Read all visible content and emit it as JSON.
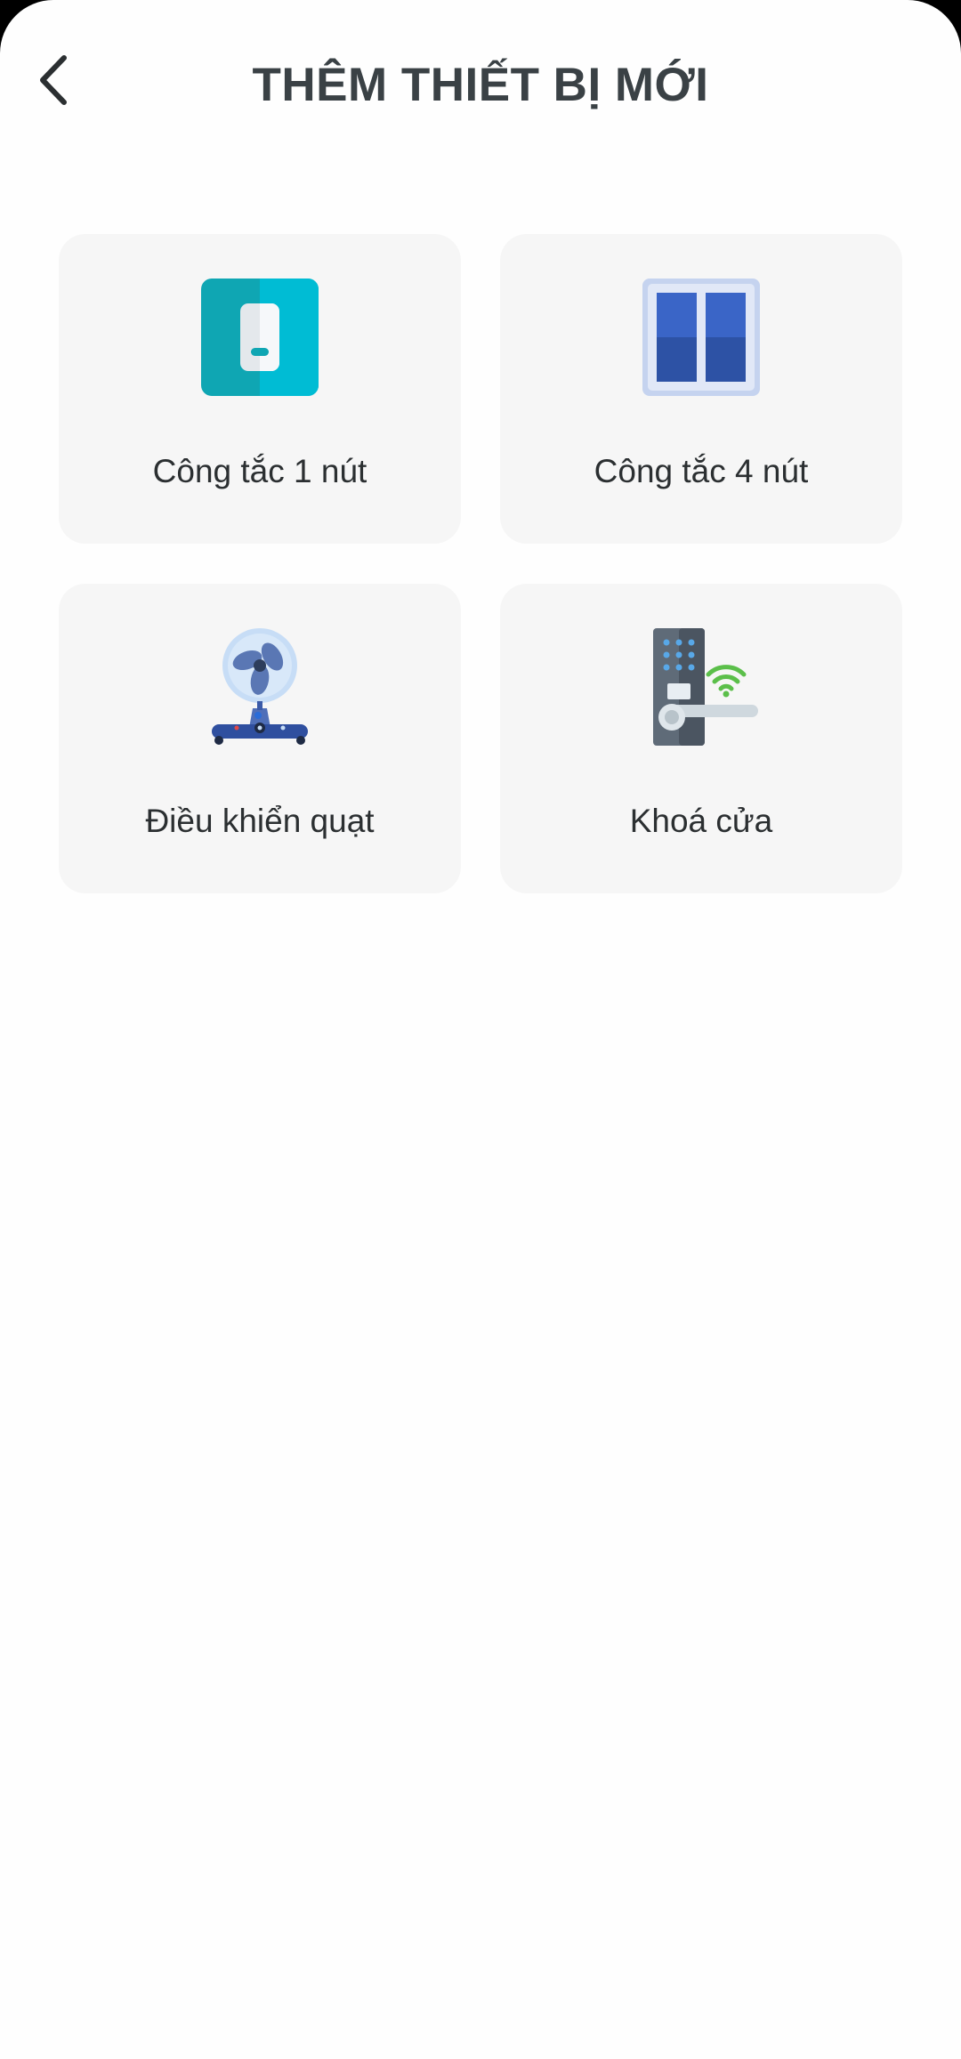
{
  "header": {
    "title": "THÊM THIẾT BỊ MỚI",
    "back_icon": "chevron-left-icon"
  },
  "devices": [
    {
      "label": "Công tắc 1 nút",
      "icon": "single-switch-icon"
    },
    {
      "label": "Công tắc 4 nút",
      "icon": "four-gang-switch-icon"
    },
    {
      "label": "Điều khiển quạt",
      "icon": "fan-icon"
    },
    {
      "label": "Khoá cửa",
      "icon": "smart-door-lock-icon"
    }
  ],
  "colors": {
    "background": "#fefefe",
    "card": "#f6f6f6",
    "title": "#3a4145",
    "label": "#2b2f31"
  }
}
